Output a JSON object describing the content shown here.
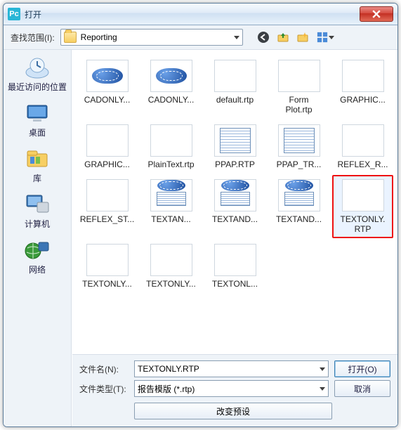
{
  "window": {
    "title": "打开"
  },
  "toolbar": {
    "lookin_label": "查找范围(I):",
    "lookin_value": "Reporting"
  },
  "places": [
    {
      "label": "最近访问的位置"
    },
    {
      "label": "桌面"
    },
    {
      "label": "库"
    },
    {
      "label": "计算机"
    },
    {
      "label": "网络"
    }
  ],
  "files": [
    {
      "name": "CADONLY...",
      "thumb": "cad",
      "selected": false
    },
    {
      "name": "CADONLY...",
      "thumb": "cad",
      "selected": false
    },
    {
      "name": "default.rtp",
      "thumb": "blank",
      "selected": false
    },
    {
      "name": "Form\nPlot.rtp",
      "thumb": "blank",
      "selected": false
    },
    {
      "name": "GRAPHIC...",
      "thumb": "blank",
      "selected": false
    },
    {
      "name": "GRAPHIC...",
      "thumb": "blank",
      "selected": false
    },
    {
      "name": "PlainText.rtp",
      "thumb": "blank",
      "selected": false
    },
    {
      "name": "PPAP.RTP",
      "thumb": "table",
      "selected": false
    },
    {
      "name": "PPAP_TR...",
      "thumb": "table",
      "selected": false
    },
    {
      "name": "REFLEX_R...",
      "thumb": "blank",
      "selected": false
    },
    {
      "name": "REFLEX_ST...",
      "thumb": "blank",
      "selected": false
    },
    {
      "name": "TEXTAN...",
      "thumb": "combo",
      "selected": false
    },
    {
      "name": "TEXTAND...",
      "thumb": "combo",
      "selected": false
    },
    {
      "name": "TEXTAND...",
      "thumb": "combo",
      "selected": false
    },
    {
      "name": "TEXTONLY.\nRTP",
      "thumb": "blank",
      "selected": true
    },
    {
      "name": "TEXTONLY...",
      "thumb": "blank",
      "selected": false
    },
    {
      "name": "TEXTONLY...",
      "thumb": "blank",
      "selected": false
    },
    {
      "name": "TEXTONL...",
      "thumb": "blank",
      "selected": false
    }
  ],
  "bottom": {
    "filename_label": "文件名(N):",
    "filename_value": "TEXTONLY.RTP",
    "filetype_label": "文件类型(T):",
    "filetype_value": "报告模版 (*.rtp)",
    "open_label": "打开(O)",
    "cancel_label": "取消",
    "preview_label": "改变预设"
  }
}
